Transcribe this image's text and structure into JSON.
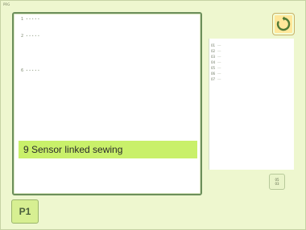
{
  "corner_label": "PRG",
  "list": {
    "rows": [
      {
        "index": "1",
        "label": "• • • • •"
      },
      {
        "index": "2",
        "label": "• • • • •"
      },
      {
        "index": "6",
        "label": "• • • • •"
      }
    ],
    "selected_label": "9 Sensor linked sewing"
  },
  "detail": {
    "items": [
      {
        "code": "01",
        "value": "---"
      },
      {
        "code": "02",
        "value": "---"
      },
      {
        "code": "03",
        "value": "---"
      },
      {
        "code": "04",
        "value": "---"
      },
      {
        "code": "05",
        "value": "---"
      },
      {
        "code": "06",
        "value": "---"
      },
      {
        "code": "07",
        "value": "---"
      }
    ]
  },
  "mid_button": {
    "line1": "05",
    "line2": "03"
  },
  "page_button": {
    "label": "P1"
  },
  "icons": {
    "top_right": "refresh-arrow-icon"
  },
  "colors": {
    "background": "#eef7cf",
    "panel_border": "#6c8f5b",
    "selection": "#c9f06a"
  }
}
